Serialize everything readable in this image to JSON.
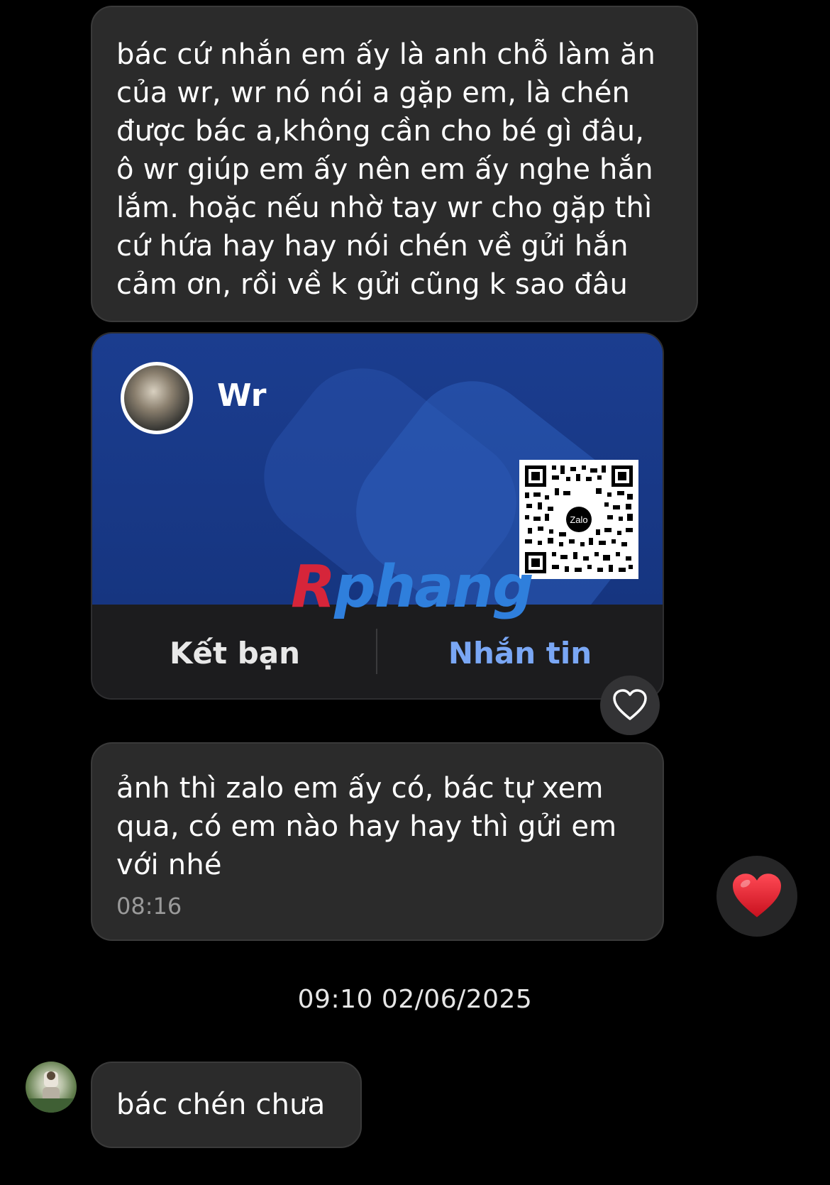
{
  "messages": [
    {
      "text": "bác cứ nhắn em ấy là anh chỗ làm ăn\ncủa wr, wr nó nói a gặp em, là chén\nđược bác a,không cần cho bé gì đâu,\nô wr giúp em ấy nên em ấy nghe hắn\nlắm. hoặc nếu nhờ tay wr cho gặp thì\ncứ hứa hay hay nói chén về gửi hắn\ncảm ơn, rồi về k gửi cũng k sao đâu"
    },
    {
      "text": "ảnh thì zalo em ấy có, bác tự xem\nqua, có em nào hay hay thì gửi em\nvới nhé",
      "time": "08:16"
    },
    {
      "text": "bác chén chưa"
    }
  ],
  "contact_card": {
    "name": "Wr",
    "qr_logo": "Zalo",
    "add_friend_label": "Kết bạn",
    "message_label": "Nhắn tin",
    "watermark_first": "R",
    "watermark_rest": "phang"
  },
  "date_separator": "09:10 02/06/2025",
  "reactions": {
    "card_reaction_icon": "heart-outline-icon",
    "message_reaction_icon": "heart-icon",
    "heart_color": "#e0202c"
  },
  "colors": {
    "background": "#000000",
    "bubble": "#2b2b2b",
    "card_banner": "#1b3d8f",
    "link_blue": "#7aa7f5"
  }
}
